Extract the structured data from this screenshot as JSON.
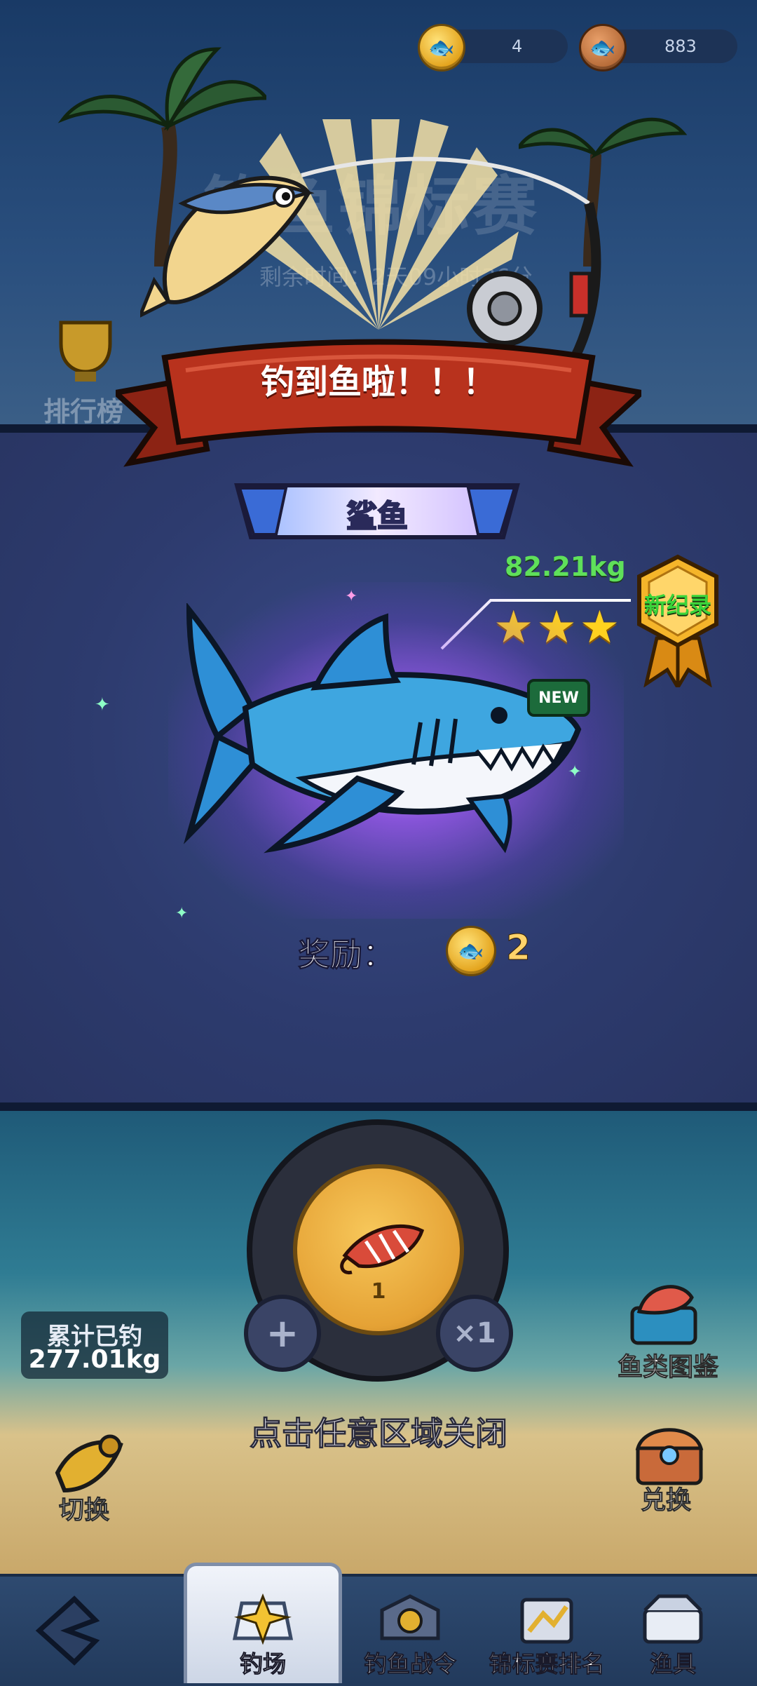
{
  "currency": {
    "tokens": {
      "icon": "gold-fish-coin-icon",
      "value": "4"
    },
    "coins": {
      "icon": "bronze-fish-coin-icon",
      "value": "883"
    }
  },
  "background": {
    "title": "钓鱼锦标赛",
    "timer": "剩余时间：2天09小时36分",
    "ranking_label": "排行榜"
  },
  "popup": {
    "banner_text": "钓到鱼啦！！！",
    "fish_name": "鲨鱼",
    "weight": "82.21kg",
    "stars": 3,
    "record_badge": "新纪录",
    "new_tag": "NEW",
    "reward_label": "奖励：",
    "reward_value": "2",
    "close_hint": "点击任意区域关闭"
  },
  "controls": {
    "bait_count": "1",
    "add_symbol": "+",
    "multiplier": "×1",
    "total_label": "累计已钓",
    "total_value": "277.01kg",
    "switch_label": "切换",
    "fish_guide_label": "鱼类图鉴",
    "exchange_label": "兑换"
  },
  "nav": {
    "items": [
      {
        "label": "钓场",
        "active": true
      },
      {
        "label": "钓鱼战令"
      },
      {
        "label": "锦标赛排名"
      },
      {
        "label": "渔具"
      }
    ]
  },
  "colors": {
    "banner_red": "#b8321d",
    "weight_green": "#5fe05a",
    "star_gold": "#ffd21f",
    "glow_purple": "#a85cff"
  }
}
